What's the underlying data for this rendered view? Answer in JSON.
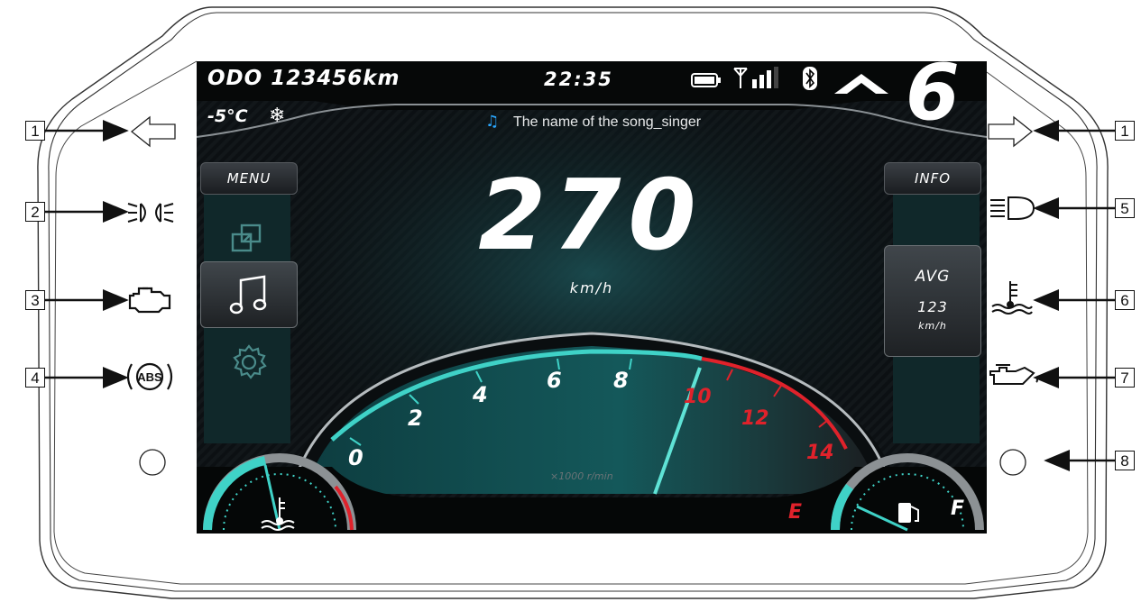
{
  "dashboard": {
    "odometer": "ODO 123456km",
    "clock": "22:35",
    "temperature": "-5°C",
    "gear": "6",
    "song": "The name of the song_singer",
    "speed": "270",
    "speed_unit": "km/h",
    "menu_label": "MENU",
    "info_label": "INFO",
    "avg_title": "AVG",
    "avg_value": "123",
    "avg_unit": "km/h",
    "rpm_unit": "×1000 r/min",
    "rpm_ticks": [
      "0",
      "2",
      "4",
      "6",
      "8",
      "10",
      "12",
      "14"
    ],
    "fuel_empty": "E",
    "fuel_full": "F"
  },
  "callouts": {
    "left": [
      "1",
      "2",
      "3",
      "4"
    ],
    "right": [
      "1",
      "5",
      "6",
      "7",
      "8"
    ]
  },
  "colors": {
    "accent": "#3fd2c7",
    "redline": "#e0222b",
    "screen_bg": "#0a0d0f"
  },
  "icons": {
    "left": [
      "turn-signal-left-icon",
      "position-light-icon",
      "engine-check-icon",
      "abs-icon"
    ],
    "right": [
      "turn-signal-right-icon",
      "high-beam-icon",
      "coolant-temp-icon",
      "oil-pressure-icon",
      "button-icon"
    ]
  }
}
